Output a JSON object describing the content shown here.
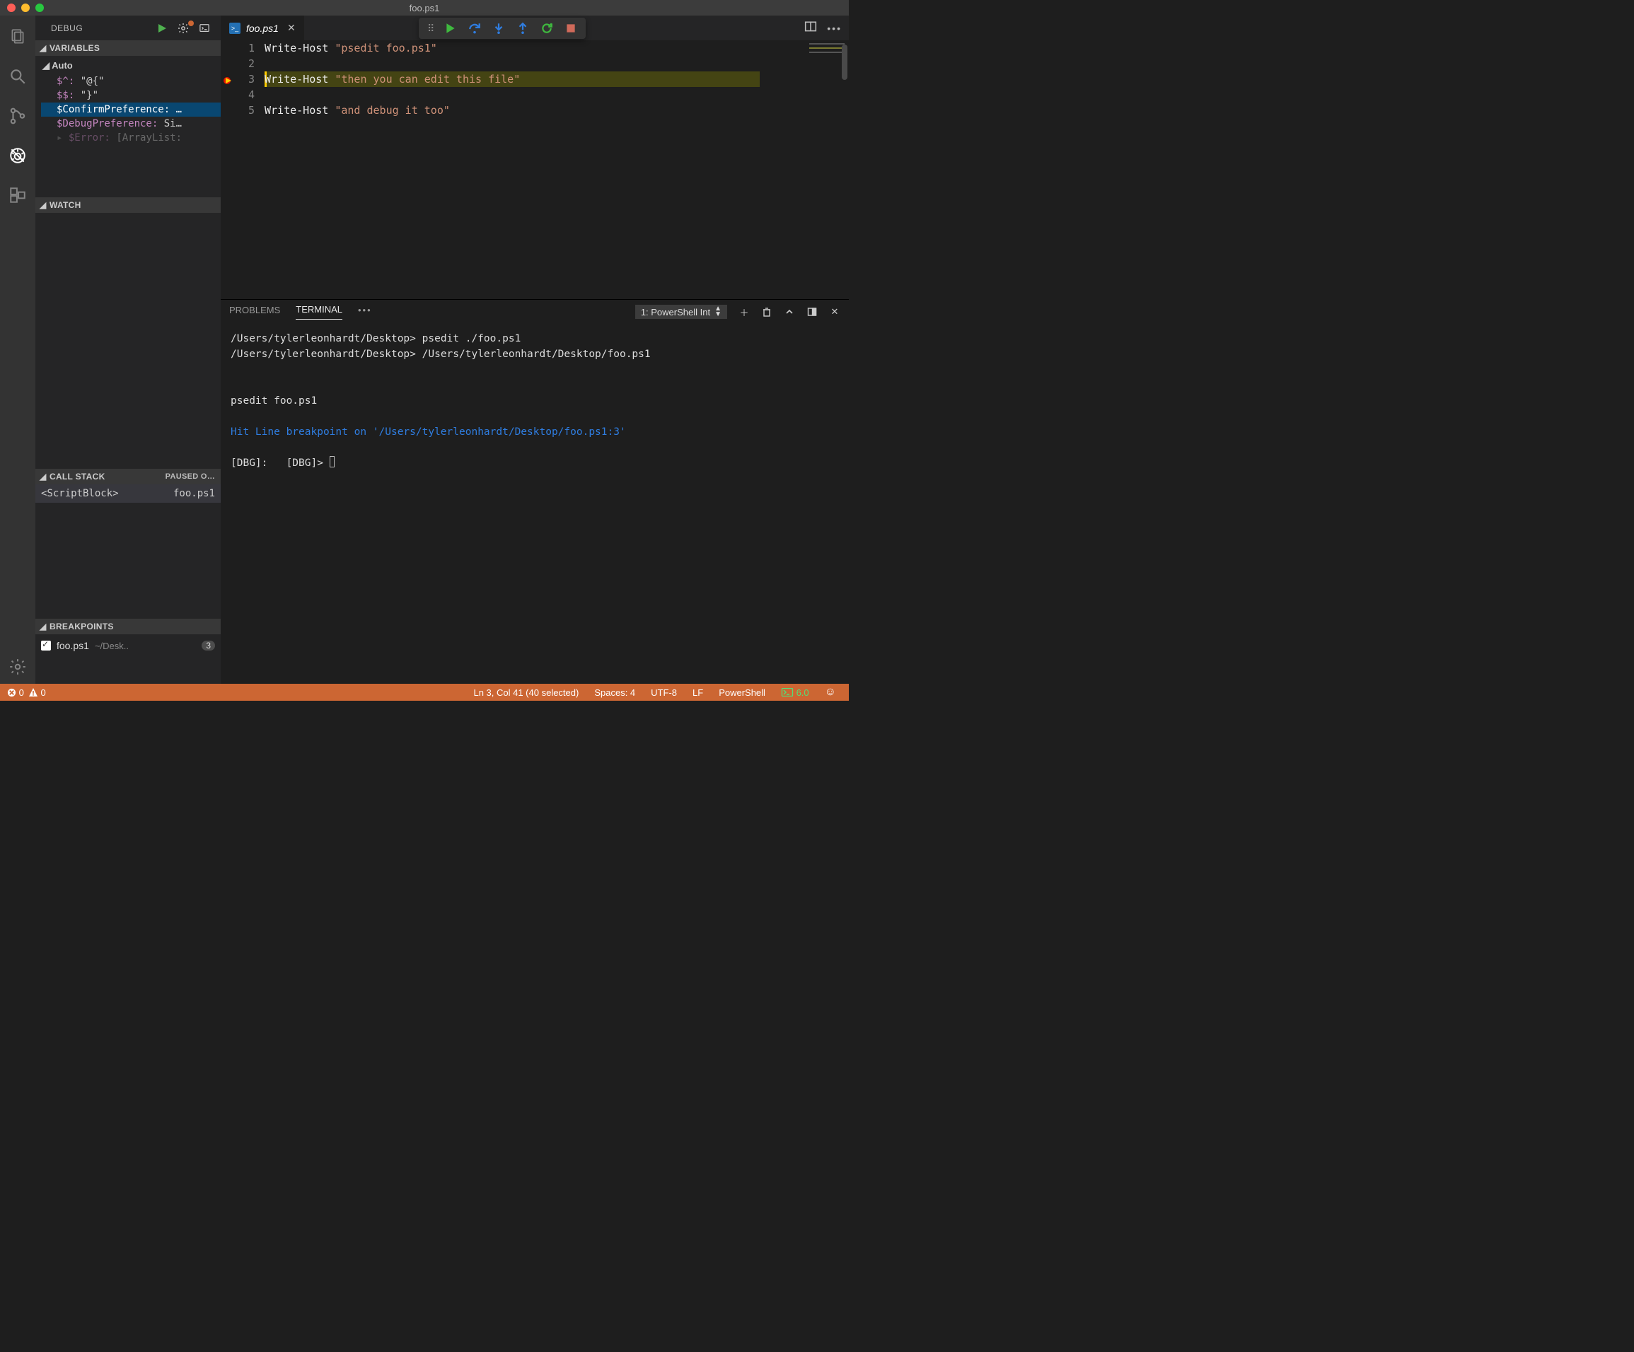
{
  "window": {
    "title": "foo.ps1"
  },
  "activity": {
    "items": [
      "explorer",
      "search",
      "scm",
      "debug",
      "extensions"
    ],
    "active": "debug"
  },
  "debugPanel": {
    "title": "DEBUG",
    "sections": {
      "variables": {
        "title": "VARIABLES",
        "autoLabel": "Auto",
        "items": [
          {
            "name": "$^:",
            "value": "\"@{\""
          },
          {
            "name": "$$:",
            "value": "\"}\""
          },
          {
            "name": "$ConfirmPreference:",
            "value": "…"
          },
          {
            "name": "$DebugPreference:",
            "value": "Si…"
          },
          {
            "name": "$Error:",
            "value": "[ArrayList:"
          }
        ]
      },
      "watch": {
        "title": "WATCH"
      },
      "callstack": {
        "title": "CALL STACK",
        "status": "PAUSED O…",
        "frames": [
          {
            "name": "<ScriptBlock>",
            "file": "foo.ps1"
          }
        ]
      },
      "breakpoints": {
        "title": "BREAKPOINTS",
        "items": [
          {
            "checked": true,
            "file": "foo.ps1",
            "dir": "~/Desk..",
            "line": "3"
          }
        ]
      }
    }
  },
  "editor": {
    "tab": {
      "filename": "foo.ps1"
    },
    "lines": [
      {
        "n": "1",
        "cmd": "Write-Host ",
        "str": "\"psedit foo.ps1\""
      },
      {
        "n": "2",
        "cmd": "",
        "str": ""
      },
      {
        "n": "3",
        "cmd": "Write-Host ",
        "str": "\"then you can edit this file\""
      },
      {
        "n": "4",
        "cmd": "",
        "str": ""
      },
      {
        "n": "5",
        "cmd": "Write-Host ",
        "str": "\"and debug it too\""
      }
    ],
    "currentLineIndex": 2
  },
  "debugToolbar": {
    "buttons": [
      "continue",
      "step-over",
      "step-into",
      "step-out",
      "restart",
      "stop"
    ]
  },
  "panel": {
    "tabs": {
      "problems": "PROBLEMS",
      "terminal": "TERMINAL"
    },
    "active": "terminal",
    "selector": "1: PowerShell Int",
    "terminalLines": {
      "l1a": "/Users/tylerleonhardt/Desktop> ",
      "l1b": "psedit ./foo.ps1",
      "l2a": "/Users/tylerleonhardt/Desktop> ",
      "l2b": "/Users/tylerleonhardt/Desktop/foo.ps1",
      "l3": "psedit foo.ps1",
      "l4": "Hit Line breakpoint on '/Users/tylerleonhardt/Desktop/foo.ps1:3'",
      "l5": "[DBG]:   [DBG]> "
    }
  },
  "statusbar": {
    "errors": "0",
    "warnings": "0",
    "cursor": "Ln 3, Col 41 (40 selected)",
    "indent": "Spaces: 4",
    "encoding": "UTF-8",
    "eol": "LF",
    "language": "PowerShell",
    "feedback": "6.0"
  }
}
